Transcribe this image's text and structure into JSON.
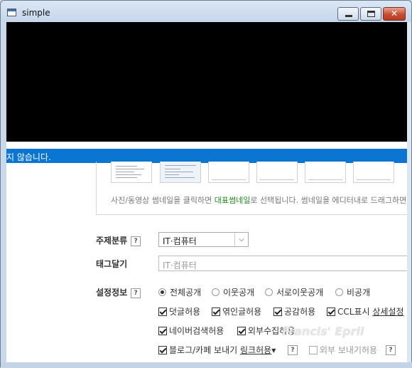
{
  "window": {
    "title": "simple"
  },
  "notice": {
    "text": "지 않습니다."
  },
  "thumbnails": {
    "help_before": "사진/동영상 썸네일을 클릭하면 ",
    "help_highlight": "대표썸네일",
    "help_after": "로 선택됩니다. 썸네일을 에디터내로 드래그하면"
  },
  "topic": {
    "label": "주제분류",
    "help": "?",
    "value": "IT·컴퓨터"
  },
  "tags": {
    "label": "태그달기",
    "value": "IT·컴퓨터"
  },
  "settings": {
    "label": "설정정보",
    "help": "?",
    "visibility": [
      "전체공개",
      "이웃공개",
      "서로이웃공개",
      "비공개"
    ],
    "visibility_selected": 0,
    "permissions_row1": [
      "덧글허용",
      "엮인글허용",
      "공감허용",
      "CCL표시"
    ],
    "ccl_link": "상세설정",
    "permissions_row2": [
      "네이버검색허용",
      "외부수집허용"
    ],
    "blog_cafe_label": "블로그/카페 보내기",
    "blog_cafe_link": "링크허용",
    "external_send": "외부 보내기허용"
  },
  "watermark": "Francis' Epril"
}
